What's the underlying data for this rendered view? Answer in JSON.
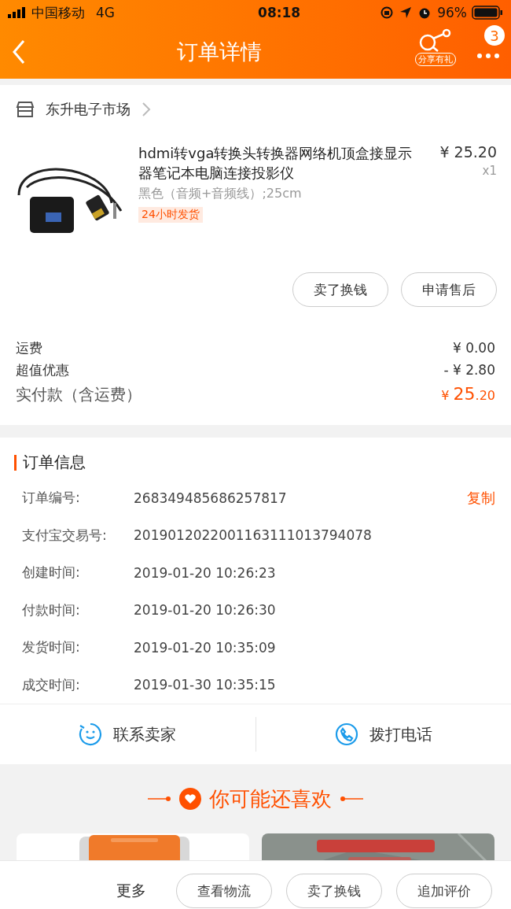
{
  "status_bar": {
    "carrier": "中国移动",
    "network": "4G",
    "time": "08:18",
    "battery": "96%"
  },
  "nav": {
    "title": "订单详情",
    "share_label": "分享有礼",
    "badge": "3"
  },
  "shop": {
    "name": "东升电子市场"
  },
  "product": {
    "title": "hdmi转vga转换头转换器网络机顶盒接显示器笔记本电脑连接投影仪",
    "sku": "黑色（音频+音频线）;25cm",
    "tag": "24小时发货",
    "price": "¥ 25.20",
    "quantity": "x1"
  },
  "item_actions": [
    "卖了换钱",
    "申请售后"
  ],
  "fees": [
    {
      "label": "运费",
      "value": "¥ 0.00"
    },
    {
      "label": "超值优惠",
      "value": "- ¥ 2.80"
    }
  ],
  "total": {
    "label": "实付款（含运费）",
    "currency": "¥",
    "integer": "25",
    "decimal": ".20"
  },
  "order_info": {
    "title": "订单信息",
    "copy_label": "复制",
    "rows": [
      {
        "label": "订单编号:",
        "value": "268349485686257817"
      },
      {
        "label": "支付宝交易号:",
        "value": "2019012022001163111013794078"
      },
      {
        "label": "创建时间:",
        "value": "2019-01-20 10:26:23"
      },
      {
        "label": "付款时间:",
        "value": "2019-01-20 10:26:30"
      },
      {
        "label": "发货时间:",
        "value": "2019-01-20 10:35:09"
      },
      {
        "label": "成交时间:",
        "value": "2019-01-30 10:35:15"
      }
    ]
  },
  "contact": [
    {
      "kind": "chat",
      "label": "联系卖家"
    },
    {
      "kind": "phone",
      "label": "拨打电话"
    }
  ],
  "recommend": {
    "title": "你可能还喜欢"
  },
  "bottom_bar": {
    "more": "更多",
    "buttons": [
      "查看物流",
      "卖了换钱",
      "追加评价"
    ]
  }
}
